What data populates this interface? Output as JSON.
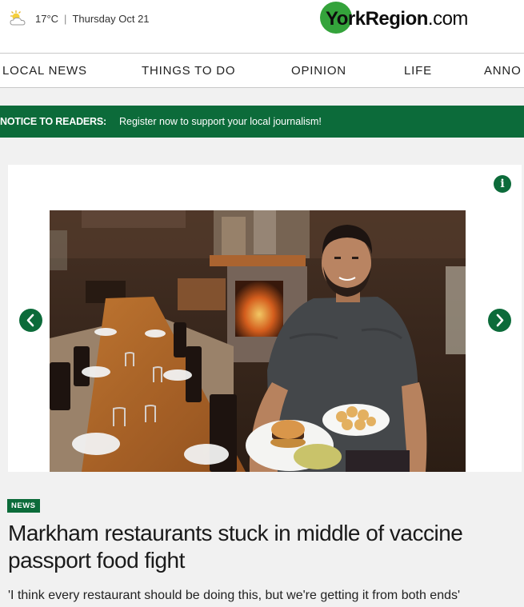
{
  "weather": {
    "icon": "partly-sunny-icon",
    "temperature": "17°C",
    "separator": "|",
    "date": "Thursday Oct 21"
  },
  "logo": {
    "york": "YorkRegion",
    "dotcom": ".com"
  },
  "nav": {
    "items": [
      "LOCAL NEWS",
      "THINGS TO DO",
      "OPINION",
      "LIFE",
      "ANNO"
    ]
  },
  "notice": {
    "label": "NOTICE TO READERS:",
    "text": "Register now to support your local journalism!"
  },
  "carousel": {
    "info": "i",
    "prev": "‹",
    "next": "›"
  },
  "article": {
    "badge": "NEWS",
    "headline": "Markham restaurants stuck in middle of vaccine passport food fight",
    "dek": "'I think every restaurant should be doing this, but we're getting it from both ends'"
  },
  "colors": {
    "brand_green": "#0c6b3a",
    "logo_green": "#34a33b"
  }
}
